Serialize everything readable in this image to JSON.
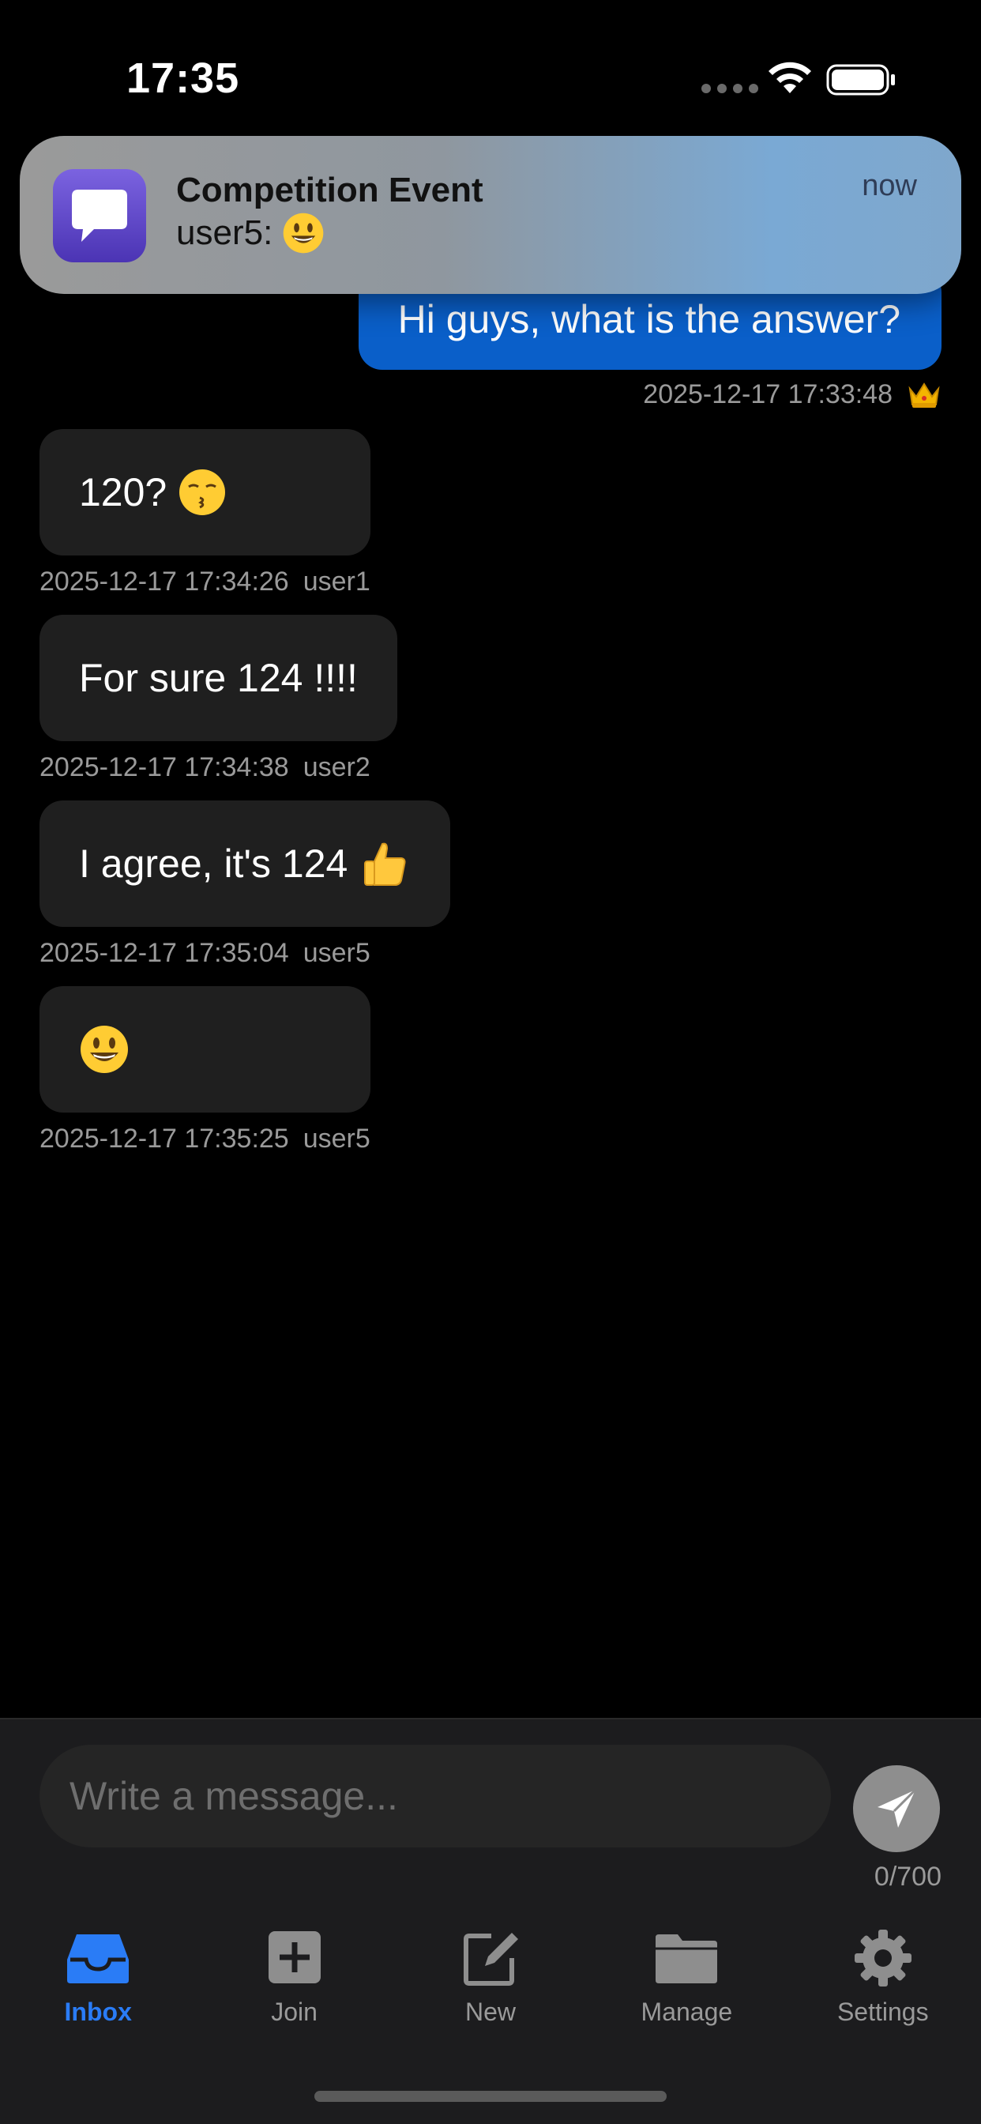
{
  "status_bar": {
    "time": "17:35"
  },
  "notification": {
    "app_icon": "chat-bubble-icon",
    "title": "Competition Event",
    "body_sender": "user5:",
    "body_emoji": "smiley-emoji",
    "time": "now"
  },
  "messages": [
    {
      "direction": "outgoing",
      "text": "Hi guys, what is the answer?",
      "timestamp": "2025-12-17 17:33:48",
      "badge": "crown-icon",
      "bubble_color": "#0a5fc9"
    },
    {
      "direction": "incoming",
      "text": "120?",
      "emoji": "kissing-emoji",
      "timestamp": "2025-12-17 17:34:26",
      "user": "user1"
    },
    {
      "direction": "incoming",
      "text": "For sure 124 !!!!",
      "timestamp": "2025-12-17 17:34:38",
      "user": "user2"
    },
    {
      "direction": "incoming",
      "text": "I agree, it's 124",
      "emoji": "thumbs-up-emoji",
      "timestamp": "2025-12-17 17:35:04",
      "user": "user5"
    },
    {
      "direction": "incoming",
      "text": "",
      "emoji": "smiley-emoji",
      "timestamp": "2025-12-17 17:35:25",
      "user": "user5"
    }
  ],
  "composer": {
    "placeholder": "Write a message...",
    "value": "",
    "char_count": "0/700"
  },
  "tabs": [
    {
      "label": "Inbox",
      "icon": "inbox-tray-icon",
      "active": true
    },
    {
      "label": "Join",
      "icon": "plus-square-icon",
      "active": false
    },
    {
      "label": "New",
      "icon": "compose-icon",
      "active": false
    },
    {
      "label": "Manage",
      "icon": "folder-icon",
      "active": false
    },
    {
      "label": "Settings",
      "icon": "gear-icon",
      "active": false
    }
  ],
  "colors": {
    "accent": "#2a7cf6",
    "outgoing_bubble": "#0a5fc9",
    "incoming_bubble": "#1f1f1f"
  }
}
